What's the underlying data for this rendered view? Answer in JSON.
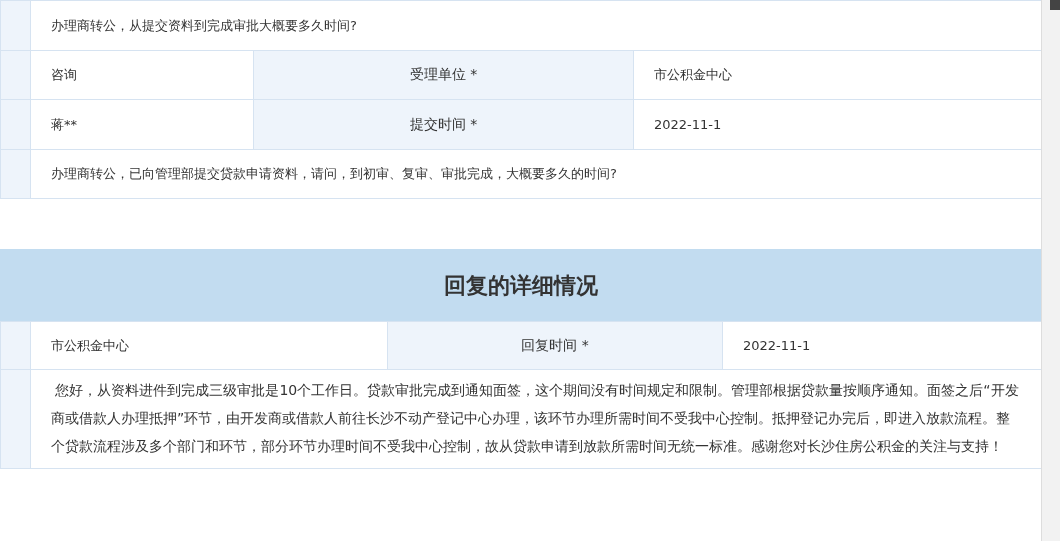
{
  "question": {
    "title": "办理商转公，从提交资料到完成审批大概要多久时间?",
    "rows": [
      {
        "value": "咨询",
        "label": "受理单位 *",
        "value_2": "市公积金中心"
      },
      {
        "value": "蒋**",
        "label": "提交时间 *",
        "value_2": "2022-11-1"
      }
    ],
    "content": "办理商转公，已向管理部提交贷款申请资料，请问，到初审、复审、审批完成，大概要多久的时间?"
  },
  "reply": {
    "heading": "回复的详细情况",
    "unit": "市公积金中心",
    "time_label": "回复时间 *",
    "time": "2022-11-1",
    "content": " 您好，从资料进件到完成三级审批是10个工作日。贷款审批完成到通知面签，这个期间没有时间规定和限制。管理部根据贷款量按顺序通知。面签之后“开发商或借款人办理抵押”环节，由开发商或借款人前往长沙不动产登记中心办理，该环节办理所需时间不受我中心控制。抵押登记办完后，即进入放款流程。整个贷款流程涉及多个部门和环节，部分环节办理时间不受我中心控制，故从贷款申请到放款所需时间无统一标准。感谢您对长沙住房公积金的关注与支持！"
  }
}
